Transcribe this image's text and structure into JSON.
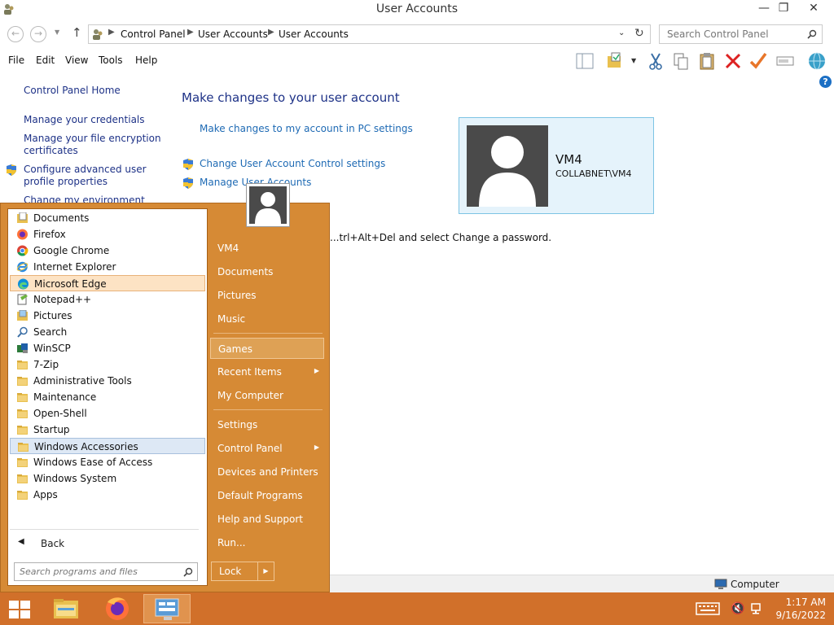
{
  "window": {
    "title": "User Accounts"
  },
  "address": {
    "crumbs": [
      "Control Panel",
      "User Accounts",
      "User Accounts"
    ],
    "search_placeholder": "Search Control Panel"
  },
  "menu": {
    "file": "File",
    "edit": "Edit",
    "view": "View",
    "tools": "Tools",
    "help": "Help"
  },
  "leftnav": {
    "home": "Control Panel Home",
    "credentials": "Manage your credentials",
    "encryption1": "Manage your file encryption",
    "encryption2": "certificates",
    "profile1": "Configure advanced user",
    "profile2": "profile properties",
    "environment": "Change my environment"
  },
  "main": {
    "heading": "Make changes to your user account",
    "pc_settings": "Make changes to my account in PC settings",
    "uac": "Change User Account Control settings",
    "manage_accounts": "Manage User Accounts",
    "password_hint": "...trl+Alt+Del and select Change a password."
  },
  "user": {
    "name": "VM4",
    "domain": "COLLABNET\\VM4"
  },
  "statusbar": {
    "computer": "Computer"
  },
  "startmenu": {
    "programs": [
      {
        "label": "Documents",
        "icon": "documents-icon"
      },
      {
        "label": "Firefox",
        "icon": "firefox-icon"
      },
      {
        "label": "Google Chrome",
        "icon": "chrome-icon"
      },
      {
        "label": "Internet Explorer",
        "icon": "ie-icon"
      },
      {
        "label": "Microsoft Edge",
        "icon": "edge-icon"
      },
      {
        "label": "Notepad++",
        "icon": "notepad-icon"
      },
      {
        "label": "Pictures",
        "icon": "pictures-icon"
      },
      {
        "label": "Search",
        "icon": "search-icon"
      },
      {
        "label": "WinSCP",
        "icon": "winscp-icon"
      },
      {
        "label": "7-Zip",
        "icon": "folder-icon"
      },
      {
        "label": "Administrative Tools",
        "icon": "folder-icon"
      },
      {
        "label": "Maintenance",
        "icon": "folder-icon"
      },
      {
        "label": "Open-Shell",
        "icon": "folder-icon"
      },
      {
        "label": "Startup",
        "icon": "folder-icon"
      },
      {
        "label": "Windows Accessories",
        "icon": "folder-icon"
      },
      {
        "label": "Windows Ease of Access",
        "icon": "folder-icon"
      },
      {
        "label": "Windows System",
        "icon": "folder-icon"
      },
      {
        "label": "Apps",
        "icon": "folder-icon"
      }
    ],
    "back": "Back",
    "search_placeholder": "Search programs and files",
    "right": {
      "user": "VM4",
      "documents": "Documents",
      "pictures": "Pictures",
      "music": "Music",
      "games": "Games",
      "recent": "Recent Items",
      "computer": "My Computer",
      "settings": "Settings",
      "control_panel": "Control Panel",
      "devices": "Devices and Printers",
      "defaults": "Default Programs",
      "help": "Help and Support",
      "run": "Run..."
    },
    "lock": "Lock"
  },
  "clock": {
    "time": "1:17 AM",
    "date": "9/16/2022"
  }
}
